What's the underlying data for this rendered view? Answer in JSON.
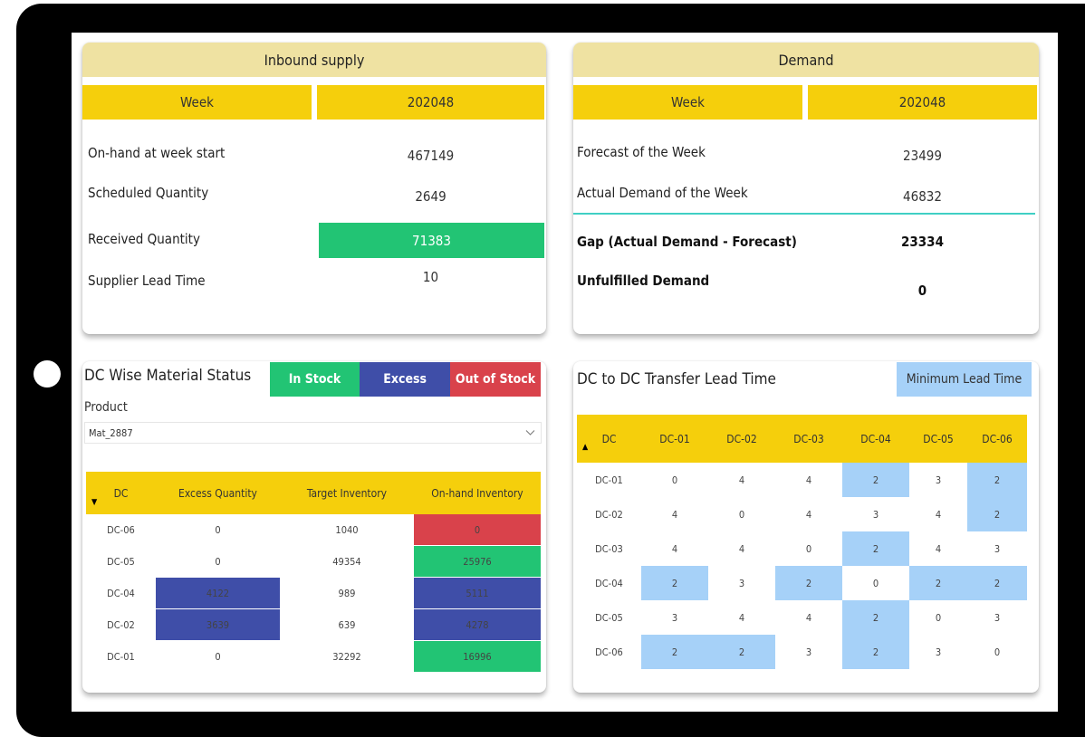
{
  "inbound": {
    "title": "Inbound supply",
    "week_label": "Week",
    "week_value": "202048",
    "rows": [
      {
        "label": "On-hand at week start",
        "value": "467149"
      },
      {
        "label": "Scheduled Quantity",
        "value": "2649"
      },
      {
        "label": "Received Quantity",
        "value": "71383"
      },
      {
        "label": "Supplier Lead Time",
        "value": "10"
      }
    ]
  },
  "demand": {
    "title": "Demand",
    "week_label": "Week",
    "week_value": "202048",
    "rows": [
      {
        "label": "Forecast of the Week",
        "value": "23499"
      },
      {
        "label": "Actual Demand of the Week",
        "value": "46832"
      },
      {
        "label": "Gap (Actual Demand - Forecast)",
        "value": "23334"
      },
      {
        "label": "Unfulfilled Demand",
        "value": "0"
      }
    ]
  },
  "dc_status": {
    "title": "DC Wise Material Status",
    "legend": {
      "in_stock": "In Stock",
      "excess": "Excess",
      "out_of_stock": "Out of Stock"
    },
    "product_label": "Product",
    "product_value": "Mat_2887",
    "columns": [
      "DC",
      "Excess Quantity",
      "Target Inventory",
      "On-hand Inventory"
    ],
    "rows": [
      {
        "dc": "DC-06",
        "excess": "0",
        "target": "1040",
        "onhand": "0",
        "excess_status": "none",
        "onhand_status": "out"
      },
      {
        "dc": "DC-05",
        "excess": "0",
        "target": "49354",
        "onhand": "25976",
        "excess_status": "none",
        "onhand_status": "in"
      },
      {
        "dc": "DC-04",
        "excess": "4122",
        "target": "989",
        "onhand": "5111",
        "excess_status": "excess",
        "onhand_status": "excess"
      },
      {
        "dc": "DC-02",
        "excess": "3639",
        "target": "639",
        "onhand": "4278",
        "excess_status": "excess",
        "onhand_status": "excess"
      },
      {
        "dc": "DC-01",
        "excess": "0",
        "target": "32292",
        "onhand": "16996",
        "excess_status": "none",
        "onhand_status": "in"
      }
    ]
  },
  "transfer": {
    "title": "DC to DC Transfer Lead Time",
    "legend_min": "Minimum Lead Time",
    "corner": "DC",
    "columns": [
      "DC-01",
      "DC-02",
      "DC-03",
      "DC-04",
      "DC-05",
      "DC-06"
    ],
    "rows": [
      {
        "dc": "DC-01",
        "values": [
          "0",
          "4",
          "4",
          "2",
          "3",
          "2"
        ],
        "min": [
          false,
          false,
          false,
          true,
          false,
          true
        ]
      },
      {
        "dc": "DC-02",
        "values": [
          "4",
          "0",
          "4",
          "3",
          "4",
          "2"
        ],
        "min": [
          false,
          false,
          false,
          false,
          false,
          true
        ]
      },
      {
        "dc": "DC-03",
        "values": [
          "4",
          "4",
          "0",
          "2",
          "4",
          "3"
        ],
        "min": [
          false,
          false,
          false,
          true,
          false,
          false
        ]
      },
      {
        "dc": "DC-04",
        "values": [
          "2",
          "3",
          "2",
          "0",
          "2",
          "2"
        ],
        "min": [
          true,
          false,
          true,
          false,
          true,
          true
        ]
      },
      {
        "dc": "DC-05",
        "values": [
          "3",
          "4",
          "4",
          "2",
          "0",
          "3"
        ],
        "min": [
          false,
          false,
          false,
          true,
          false,
          false
        ]
      },
      {
        "dc": "DC-06",
        "values": [
          "2",
          "2",
          "3",
          "2",
          "3",
          "0"
        ],
        "min": [
          true,
          true,
          false,
          true,
          false,
          false
        ]
      }
    ]
  },
  "colors": {
    "yellow": "#f5cf0c",
    "header_beige": "#efe2a2",
    "in_stock_green": "#22c474",
    "excess_blue": "#3f4ea8",
    "out_of_stock_red": "#d9424b",
    "min_lead_light_blue": "#a6d1f8",
    "divider_teal": "#3fcfc4"
  }
}
